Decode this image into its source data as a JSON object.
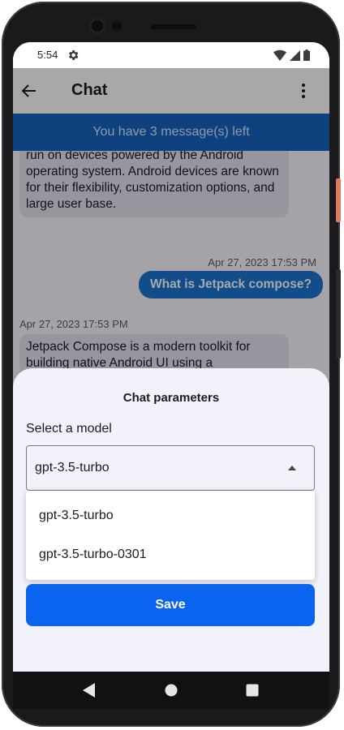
{
  "status_bar": {
    "time": "5:54",
    "icons": [
      "settings-icon",
      "wifi-icon",
      "signal-icon",
      "battery-icon"
    ]
  },
  "app_bar": {
    "title": "Chat",
    "back_icon": "arrow-back-icon",
    "menu_icon": "more-vert-icon"
  },
  "banner": {
    "text": "You have 3 message(s) left",
    "color": "#1565c0"
  },
  "messages": [
    {
      "role": "assistant",
      "text": "run on devices powered by the Android operating system. Android devices are known for their flexibility, customization options, and large user base."
    },
    {
      "role": "user",
      "timestamp": "Apr 27, 2023 17:53 PM",
      "text": "What is Jetpack compose?"
    },
    {
      "role": "assistant",
      "timestamp": "Apr 27, 2023 17:53 PM",
      "text": "Jetpack Compose is a modern toolkit for building native Android UI using a"
    }
  ],
  "sheet": {
    "title": "Chat parameters",
    "model_label": "Select a model",
    "selected_model": "gpt-3.5-turbo",
    "options": [
      "gpt-3.5-turbo",
      "gpt-3.5-turbo-0301"
    ],
    "save_label": "Save",
    "accent": "#0a64f0"
  },
  "nav_bar": {
    "icons": [
      "back-triangle-icon",
      "home-circle-icon",
      "recents-square-icon"
    ]
  }
}
